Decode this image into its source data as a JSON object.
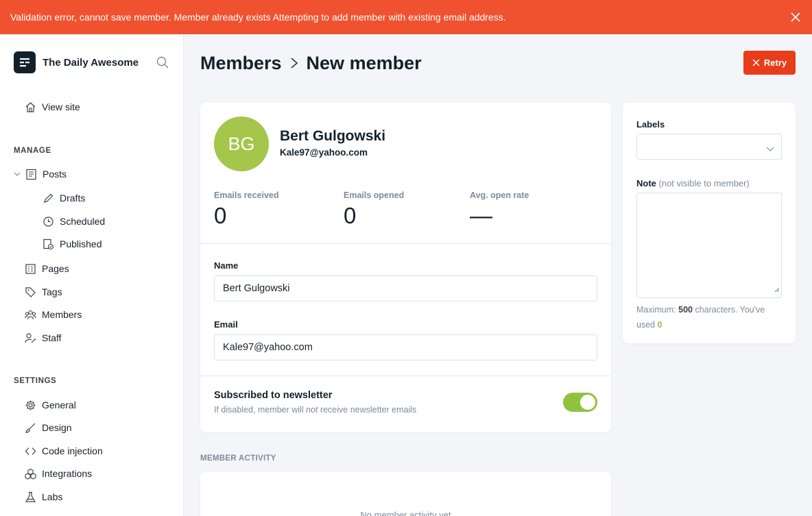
{
  "alert": {
    "message": "Validation error, cannot save member. Member already exists Attempting to add member with existing email address.",
    "close_icon": "close-icon"
  },
  "sidebar": {
    "site_name": "The Daily Awesome",
    "view_site": "View site",
    "manage_title": "MANAGE",
    "settings_title": "SETTINGS",
    "manage_items": {
      "posts": "Posts",
      "drafts": "Drafts",
      "scheduled": "Scheduled",
      "published": "Published",
      "pages": "Pages",
      "tags": "Tags",
      "members": "Members",
      "staff": "Staff"
    },
    "settings_items": {
      "general": "General",
      "design": "Design",
      "code_injection": "Code injection",
      "integrations": "Integrations",
      "labs": "Labs"
    }
  },
  "header": {
    "breadcrumb_parent": "Members",
    "breadcrumb_current": "New member",
    "retry_label": "Retry"
  },
  "member": {
    "initials": "BG",
    "name": "Bert Gulgowski",
    "email": "Kale97@yahoo.com",
    "avatar_color": "#a4c64b"
  },
  "stats": {
    "emails_received_label": "Emails received",
    "emails_received_value": "0",
    "emails_opened_label": "Emails opened",
    "emails_opened_value": "0",
    "open_rate_label": "Avg. open rate",
    "open_rate_value": "—"
  },
  "form": {
    "name_label": "Name",
    "name_value": "Bert Gulgowski",
    "email_label": "Email",
    "email_value": "Kale97@yahoo.com",
    "newsletter_title": "Subscribed to newsletter",
    "newsletter_desc_pre": "If disabled, member will ",
    "newsletter_desc_em": "not",
    "newsletter_desc_post": " receive newsletter emails",
    "newsletter_enabled": true
  },
  "side": {
    "labels_label": "Labels",
    "note_label": "Note",
    "note_hint": "(not visible to member)",
    "max_pre": "Maximum: ",
    "max_value": "500",
    "max_mid": " characters. You've used ",
    "used_value": "0"
  },
  "activity": {
    "section_label": "MEMBER ACTIVITY",
    "empty_text": "No member activity yet"
  },
  "colors": {
    "alert": "#f05230",
    "retry": "#e83d1a",
    "toggle_on": "#8fc33f"
  }
}
